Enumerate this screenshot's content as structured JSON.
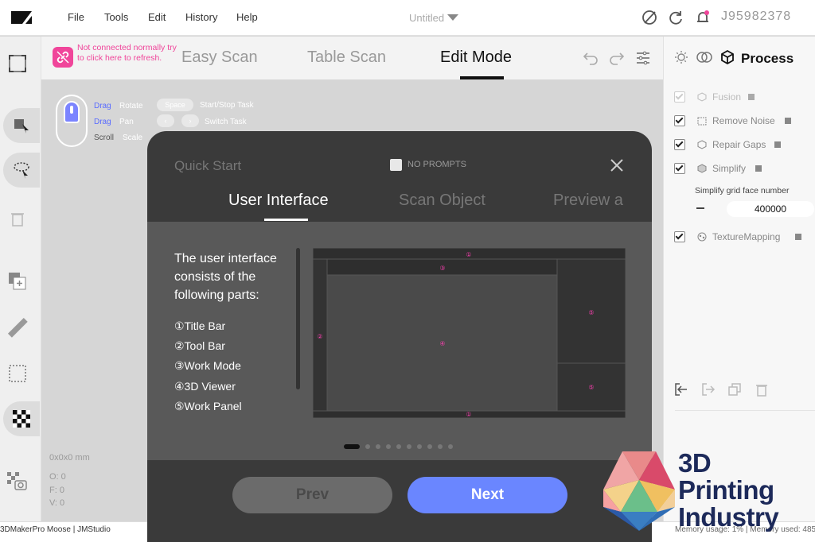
{
  "menubar": {
    "items": [
      "File",
      "Tools",
      "Edit",
      "History",
      "Help"
    ],
    "doc_title": "Untitled",
    "user_id": "J95982378"
  },
  "modebar": {
    "connection_warning": "Not connected normally try to click here to refresh.",
    "tabs": [
      "Easy Scan",
      "Table Scan",
      "Edit Mode"
    ],
    "active_tab": "Edit Mode"
  },
  "viewer": {
    "hints": {
      "drag1": "Drag",
      "rotate": "Rotate",
      "drag2": "Drag",
      "pan": "Pan",
      "scroll": "Scroll",
      "scale": "Scale",
      "space_key": "Space",
      "start_stop": "Start/Stop Task",
      "switch_task": "Switch Task"
    },
    "dimensions": "0x0x0 mm",
    "o_label": "O: 0",
    "f_label": "F: 0",
    "v_label": "V: 0"
  },
  "right_panel": {
    "title": "Process",
    "options": [
      {
        "label": "Fusion",
        "checked": true,
        "disabled": true
      },
      {
        "label": "Remove Noise",
        "checked": true,
        "disabled": false
      },
      {
        "label": "Repair Gaps",
        "checked": true,
        "disabled": false
      },
      {
        "label": "Simplify",
        "checked": true,
        "disabled": false
      },
      {
        "label": "TextureMapping",
        "checked": true,
        "disabled": false
      }
    ],
    "simplify_label": "Simplify grid face number",
    "simplify_value": "400000"
  },
  "statusbar": {
    "left": "3DMakerPro Moose  |  JMStudio",
    "right": "Memory usage: 1%  |  Memory used: 485"
  },
  "modal": {
    "title": "Quick Start",
    "no_prompts": "NO PROMPTS",
    "tabs": [
      "User Interface",
      "Scan Object",
      "Preview a"
    ],
    "active_tab": "User Interface",
    "description": "The user interface consists of the following parts:",
    "parts": [
      "①Title Bar",
      "②Tool Bar",
      "③Work Mode",
      "④3D Viewer",
      "⑤Work Panel"
    ],
    "diagram_markers": [
      "①",
      "②",
      "③",
      "④",
      "⑤"
    ],
    "pagination": {
      "current": 1,
      "total": 10
    },
    "prev_label": "Prev",
    "next_label": "Next"
  },
  "watermark": {
    "line1": "3D",
    "line2": "Printing",
    "line3": "Industry"
  },
  "colors": {
    "accent_blue": "#6a86ff",
    "warning_pink": "#f0459a",
    "marker_pink": "#ff3fb3"
  }
}
